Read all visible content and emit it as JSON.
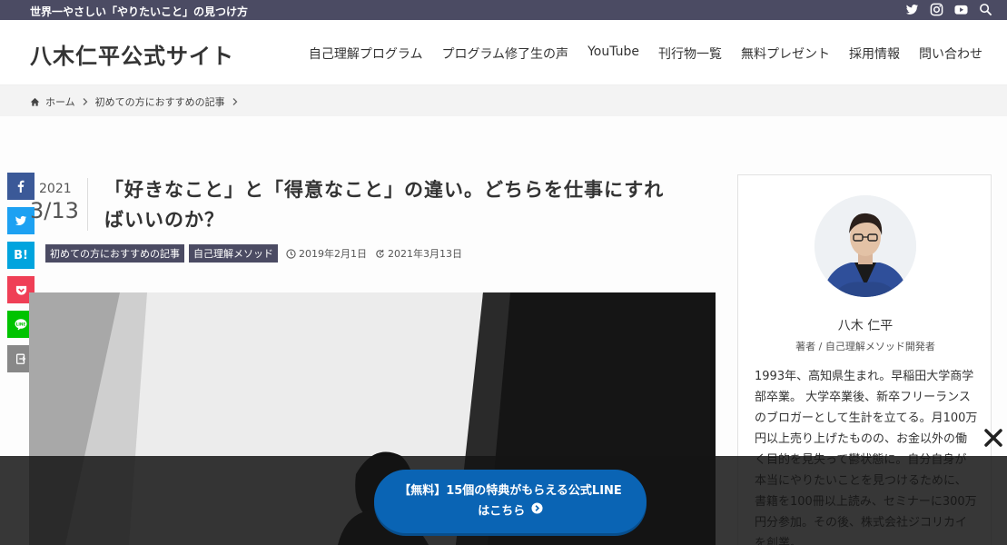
{
  "topbar": {
    "tagline": "世界一やさしい「やりたいこと」の見つけ方",
    "icons": [
      "twitter-icon",
      "instagram-icon",
      "youtube-icon",
      "search-icon"
    ]
  },
  "header": {
    "site_title": "八木仁平公式サイト",
    "nav": [
      "自己理解プログラム",
      "プログラム修了生の声",
      "YouTube",
      "刊行物一覧",
      "無料プレゼント",
      "採用情報",
      "問い合わせ"
    ]
  },
  "breadcrumb": {
    "home": "ホーム",
    "category": "初めての方におすすめの記事"
  },
  "share": [
    "facebook-icon",
    "twitter-icon",
    "hatena-bookmark-icon",
    "pocket-icon",
    "line-icon",
    "copy-icon"
  ],
  "share_hatena_label": "B!",
  "post": {
    "year": "2021",
    "month_day": "3/13",
    "title_line1": "「好きなこと」と「得意なこと」の違い。どちらを仕事にすれ",
    "title_line2": "ばいいのか？",
    "tags": [
      "初めての方におすすめの記事",
      "自己理解メソッド"
    ],
    "published": "2019年2月1日",
    "updated": "2021年3月13日"
  },
  "sidebar": {
    "name": "八木 仁平",
    "role": "著者 / 自己理解メソッド開発者",
    "bio": "1993年、高知県生まれ。早稲田大学商学部卒業。 大学卒業後、新卒フリーランスのブロガーとして生計を立てる。月100万円以上売り上げたものの、お金以外の働く目的を見失って鬱状態に。自分自身が本当にやりたいことを見つけるために、書籍を100冊以上読み、セミナーに300万円分参加。その後、株式会社ジコリカイを創業。"
  },
  "cta": {
    "line1": "【無料】15個の特典がもらえる公式LINE",
    "line2": "はこちら"
  },
  "colors": {
    "topbar": "#4b4b63",
    "tag": "#4b4b63",
    "cta": "#0a64b4",
    "facebook": "#3b5998",
    "twitter": "#1da1f2",
    "hatena": "#00a4de",
    "pocket": "#ef3f56",
    "line": "#00c300",
    "copy": "#888888"
  }
}
